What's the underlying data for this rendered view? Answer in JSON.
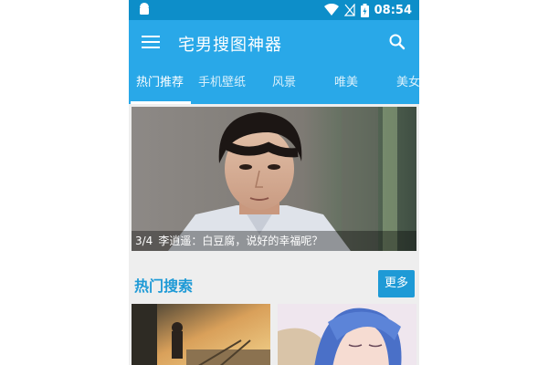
{
  "status_bar": {
    "time": "08:54"
  },
  "app_bar": {
    "title": "宅男搜图神器"
  },
  "tabs": [
    {
      "label": "热门推荐",
      "active": true
    },
    {
      "label": "手机壁纸",
      "active": false
    },
    {
      "label": "风景",
      "active": false
    },
    {
      "label": "唯美",
      "active": false
    },
    {
      "label": "美女",
      "active": false
    }
  ],
  "banner": {
    "counter": "3/4",
    "caption": "李逍遥：白豆腐，说好的幸福呢？"
  },
  "hot_search": {
    "title": "热门搜索",
    "more_label": "更多"
  },
  "colors": {
    "primary": "#29a8e8",
    "status_bar": "#0d8ec9",
    "accent": "#1e9ad6"
  }
}
